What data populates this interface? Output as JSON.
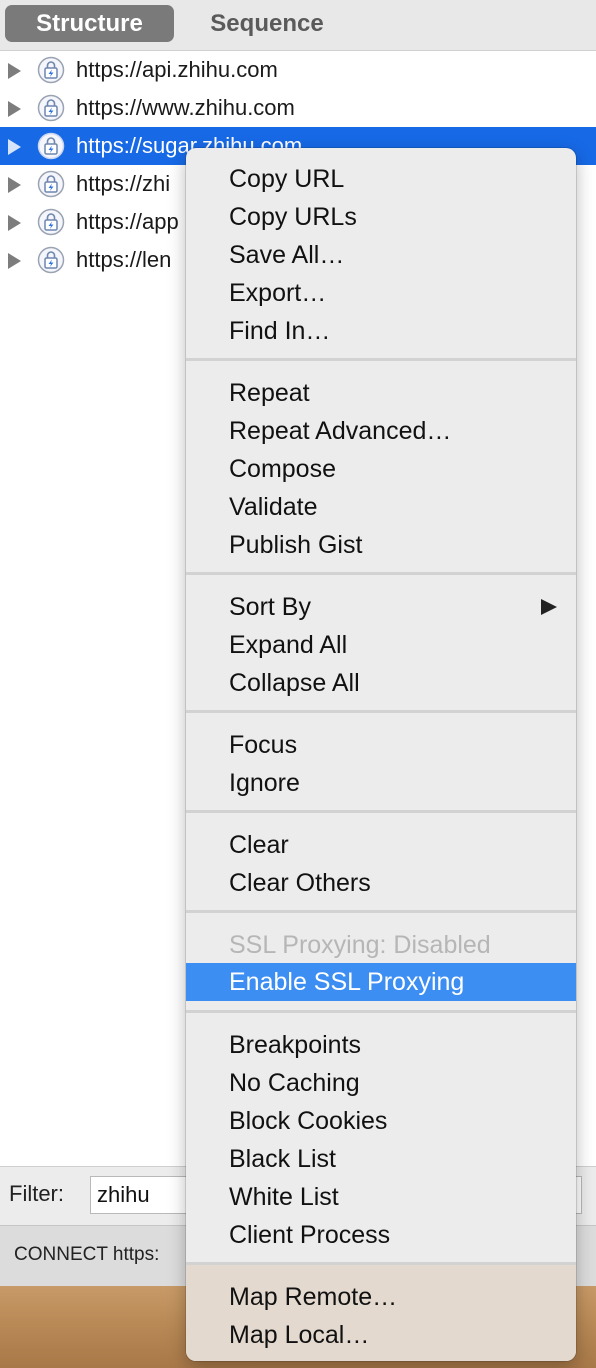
{
  "tabs": {
    "structure": "Structure",
    "sequence": "Sequence"
  },
  "tree": {
    "rows": [
      {
        "label": "https://api.zhihu.com",
        "selected": false
      },
      {
        "label": "https://www.zhihu.com",
        "selected": false
      },
      {
        "label": "https://sugar.zhihu.com",
        "selected": true
      },
      {
        "label": "https://zhi",
        "selected": false
      },
      {
        "label": "https://app",
        "selected": false
      },
      {
        "label": "https://len",
        "selected": false
      }
    ]
  },
  "filter": {
    "label": "Filter:",
    "value": "zhihu"
  },
  "status": {
    "text": "CONNECT https:"
  },
  "context_menu": {
    "copy_url": "Copy URL",
    "copy_urls": "Copy URLs",
    "save_all": "Save All…",
    "export": "Export…",
    "find_in": "Find In…",
    "repeat": "Repeat",
    "repeat_advanced": "Repeat Advanced…",
    "compose": "Compose",
    "validate": "Validate",
    "publish_gist": "Publish Gist",
    "sort_by": "Sort By",
    "expand_all": "Expand All",
    "collapse_all": "Collapse All",
    "focus": "Focus",
    "ignore": "Ignore",
    "clear": "Clear",
    "clear_others": "Clear Others",
    "ssl_status": "SSL Proxying: Disabled",
    "enable_ssl": "Enable SSL Proxying",
    "breakpoints": "Breakpoints",
    "no_caching": "No Caching",
    "block_cookies": "Block Cookies",
    "black_list": "Black List",
    "white_list": "White List",
    "client_process": "Client Process",
    "map_remote": "Map Remote…",
    "map_local": "Map Local…"
  },
  "colors": {
    "selection": "#1769e6",
    "menu_highlight": "#3d8ef3",
    "active_tab": "#7a7a7a"
  }
}
